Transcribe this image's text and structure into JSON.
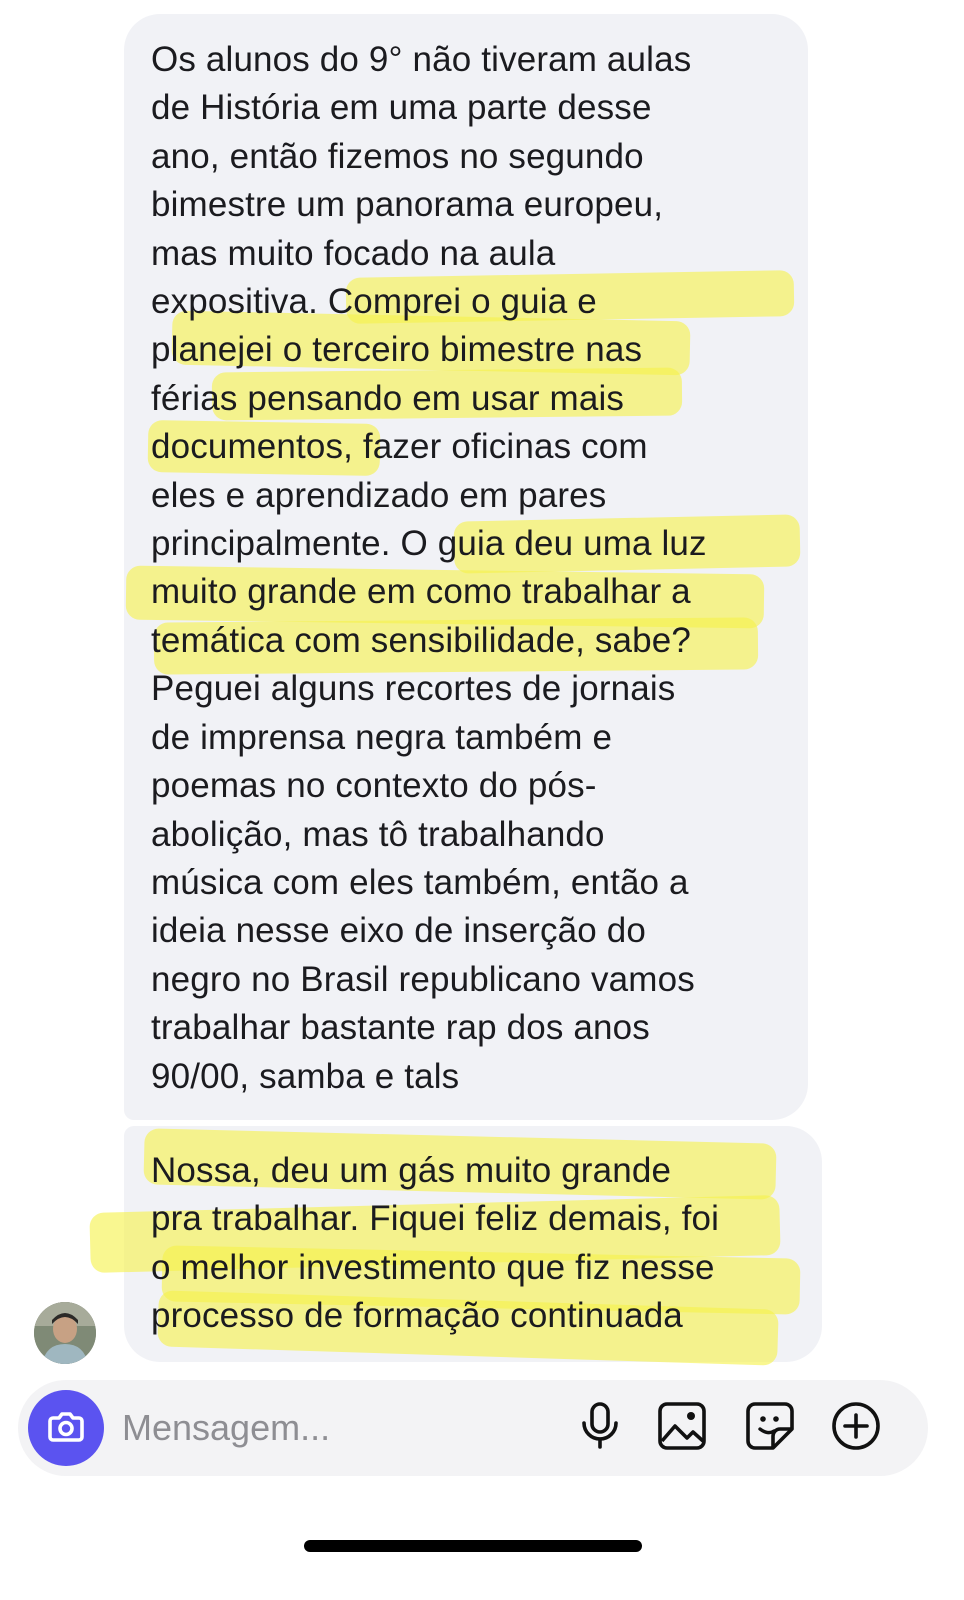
{
  "messages": [
    {
      "text": "Os alunos do 9° não tiveram aulas\nde História em uma parte desse\nano, então fizemos no segundo\nbimestre um panorama europeu,\nmas muito focado na aula\nexpositiva. Comprei o guia e\nplanejei o terceiro bimestre nas\nférias pensando em usar mais\ndocumentos, fazer oficinas com\neles e aprendizado em pares\nprincipalmente. O guia deu uma luz\nmuito grande em como trabalhar a\ntemática com sensibilidade, sabe?\nPeguei alguns recortes de jornais\nde imprensa negra também e\npoemas no contexto do pós-\nabolição, mas tô trabalhando\nmúsica com eles também, então a\nideia nesse eixo de inserção do\nnegro no Brasil republicano vamos\ntrabalhar bastante rap dos anos\n90/00, samba e tals"
    },
    {
      "text": "Nossa, deu um gás muito grande\npra trabalhar. Fiquei feliz demais, foi\no melhor investimento que fiz nesse\nprocesso de formação continuada"
    }
  ],
  "composer": {
    "placeholder": "Mensagem...",
    "value": ""
  },
  "icons": {
    "camera": "camera-icon",
    "mic": "microphone-icon",
    "gallery": "image-icon",
    "sticker": "sticker-icon",
    "add": "plus-circle-icon"
  },
  "colors": {
    "bubble_background": "#f1f2f6",
    "highlight": "#f6f24c",
    "camera_button": "#5b53f0",
    "text": "#1b1b1f",
    "placeholder": "#8e8e93"
  }
}
